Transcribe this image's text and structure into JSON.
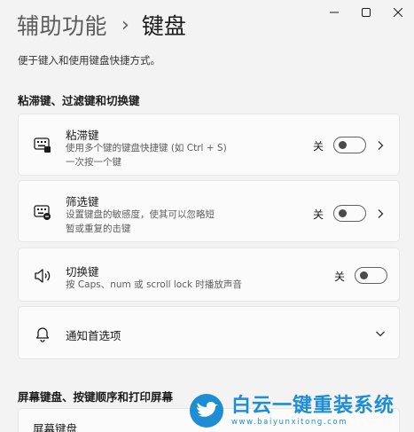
{
  "window": {
    "title_parent": "辅助功能",
    "title_current": "键盘"
  },
  "subtitle": "便于键入和使用键盘快捷方式。",
  "sections": {
    "keys": "粘滞键、过滤键和切换键",
    "screen": "屏幕键盘、按键顺序和打印屏幕"
  },
  "cards": {
    "sticky": {
      "title": "粘滞键",
      "desc_line1": "使用多个键的键盘快捷键 (如 Ctrl + S)",
      "desc_line2": "一次按一个键",
      "toggle_label": "关",
      "toggle_on": false,
      "icon": "sticky-keys-icon"
    },
    "filter": {
      "title": "筛选键",
      "desc_line1": "设置键盘的敏感度，使其可以忽略短",
      "desc_line2": "暂或重复的击键",
      "toggle_label": "关",
      "toggle_on": false,
      "icon": "filter-keys-icon"
    },
    "toggle_keys": {
      "title": "切换键",
      "desc_line1": "按 Caps、num 或 scroll lock 时播放声音",
      "toggle_label": "关",
      "toggle_on": false,
      "icon": "speaker-icon"
    },
    "notify": {
      "title": "通知首选项",
      "icon": "bell-icon"
    },
    "onscreen": {
      "title": "屏幕键盘"
    }
  },
  "watermark": {
    "text": "白云一键重装系统",
    "url": "www.baiyunxitong.com",
    "color": "#1d8ed6"
  }
}
